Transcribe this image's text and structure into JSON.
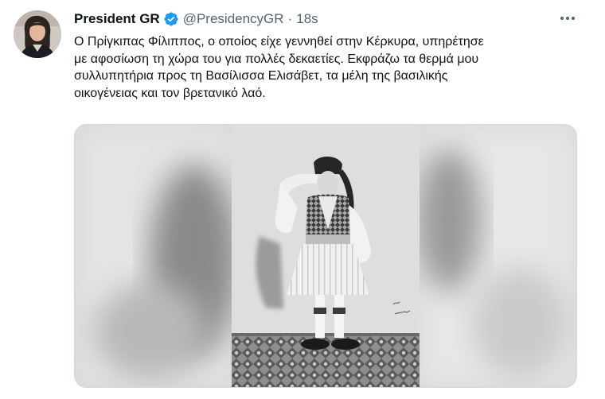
{
  "user": {
    "display_name": "President GR",
    "handle": "@PresidencyGR",
    "separator": "·",
    "timestamp": "18s"
  },
  "tweet": {
    "lines": [
      "Ο Πρίγκιπας Φίλιππος, ο οποίος είχε γεννηθεί στην Κέρκυρα, υπηρέτησε",
      "με αφοσίωση τη χώρα του για πολλές δεκαετίες. Εκφράζω τα θερμά μου",
      "συλλυπητήρια προς τη Βασίλισσα Ελισάβετ, τα μέλη της βασιλικής",
      "οικογένειας και τον βρετανικό λαό."
    ]
  },
  "icons": {
    "verified": "verified-badge-icon",
    "more": "more-options-icon"
  },
  "colors": {
    "verified": "#1d9bf0",
    "secondary_text": "#536471",
    "primary_text": "#0f1419",
    "border": "#cfd9de"
  }
}
